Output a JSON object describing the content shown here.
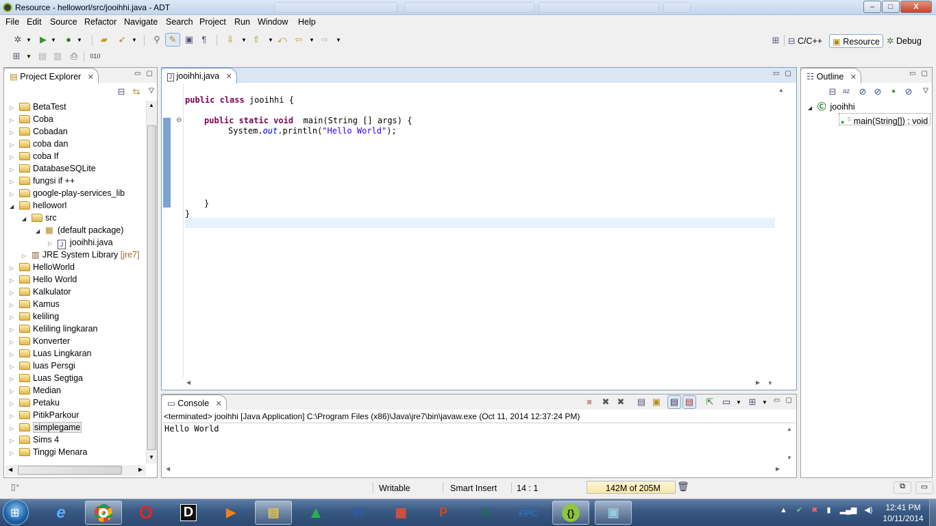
{
  "window": {
    "title": "Resource - helloworl/src/jooihhi.java - ADT",
    "controls": {
      "minimize": "–",
      "maximize": "□",
      "close": "X"
    }
  },
  "menubar": [
    "File",
    "Edit",
    "Source",
    "Refactor",
    "Navigate",
    "Search",
    "Project",
    "Run",
    "Window",
    "Help"
  ],
  "perspectives": {
    "cpp": "C/C++",
    "resource": "Resource",
    "debug": "Debug"
  },
  "project_explorer": {
    "title": "Project Explorer",
    "items": [
      {
        "label": "BetaTest"
      },
      {
        "label": "Coba"
      },
      {
        "label": "Cobadan"
      },
      {
        "label": "coba dan"
      },
      {
        "label": "coba If"
      },
      {
        "label": "DatabaseSQLite"
      },
      {
        "label": "fungsi if ++"
      },
      {
        "label": "google-play-services_lib"
      },
      {
        "label": "helloworl"
      },
      {
        "label": "src"
      },
      {
        "label": "(default package)"
      },
      {
        "label": "jooihhi.java"
      },
      {
        "label": "JRE System Library",
        "suffix": "[jre7]"
      },
      {
        "label": "HelloWorld"
      },
      {
        "label": "Hello World"
      },
      {
        "label": "Kalkulator"
      },
      {
        "label": "Kamus"
      },
      {
        "label": "keliling"
      },
      {
        "label": "Keliling lingkaran"
      },
      {
        "label": "Konverter"
      },
      {
        "label": "Luas Lingkaran"
      },
      {
        "label": "luas Persgi"
      },
      {
        "label": "Luas Segtiga"
      },
      {
        "label": "Median"
      },
      {
        "label": "Petaku"
      },
      {
        "label": "PitikParkour"
      },
      {
        "label": "simplegame"
      },
      {
        "label": "Sims 4"
      },
      {
        "label": "Tinggi Menara"
      }
    ]
  },
  "editor": {
    "tab": "jooihhi.java",
    "code": {
      "l1_kw": "public class",
      "l1_rest": " jooihhi {",
      "l2_kw": "public static void",
      "l2_rest": "  main(String [] args) {",
      "l3_a": "System.",
      "l3_out": "out",
      "l3_b": ".println(",
      "l3_str": "\"Hello World\"",
      "l3_c": ");",
      "l4": "}",
      "l5": "}"
    }
  },
  "outline": {
    "title": "Outline",
    "class": "jooihhi",
    "method": "main(String[]) : void"
  },
  "console": {
    "title": "Console",
    "header": "<terminated> jooihhi [Java Application] C:\\Program Files (x86)\\Java\\jre7\\bin\\javaw.exe (Oct 11, 2014 12:37:24 PM)",
    "output": "Hello World"
  },
  "statusbar": {
    "writable": "Writable",
    "insert": "Smart Insert",
    "position": "14 : 1",
    "heap": "142M of 205M"
  },
  "taskbar": {
    "time": "12:41 PM",
    "date": "10/11/2014",
    "apps": [
      "start",
      "internet-explorer",
      "chrome",
      "opera",
      "d-app",
      "media",
      "explorer",
      "green-app",
      "word",
      "winrar",
      "powerpoint",
      "excel",
      "fpc",
      "adt",
      "control-panel"
    ]
  }
}
